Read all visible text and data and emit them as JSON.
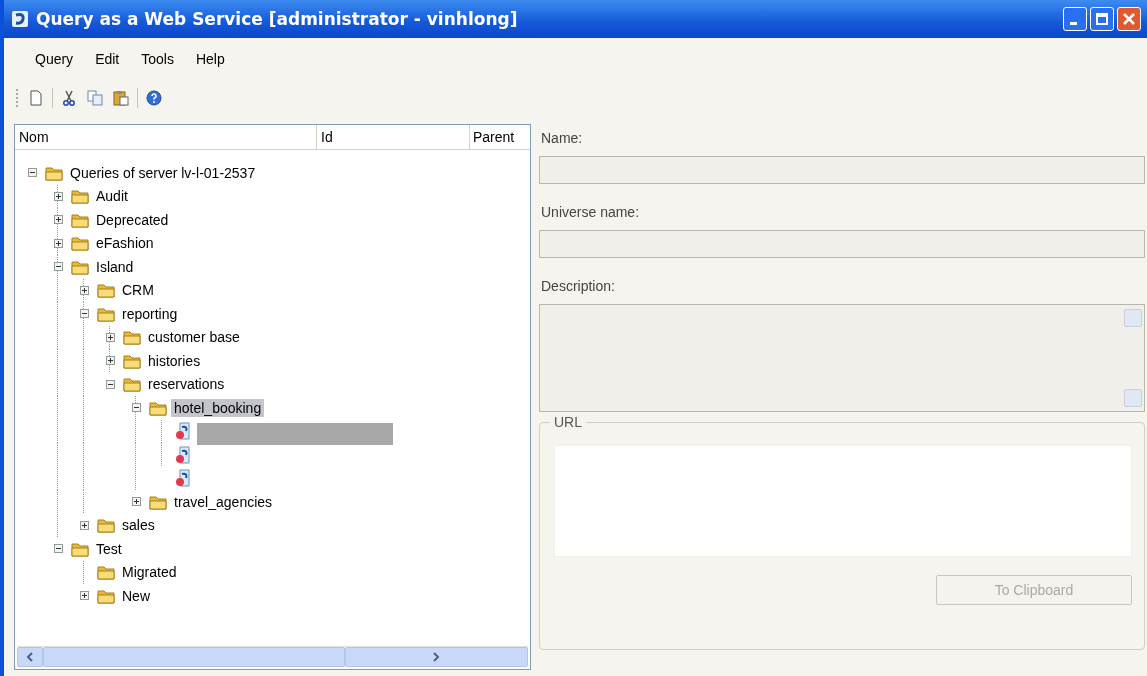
{
  "window": {
    "title": "Query as a Web Service [administrator - vinhlong]"
  },
  "menu": [
    "Query",
    "Edit",
    "Tools",
    "Help"
  ],
  "tree": {
    "columns": [
      "Nom",
      "Id",
      "Parent"
    ],
    "nodes": [
      {
        "label": "Queries of server lv-l-01-2537",
        "kind": "folder",
        "expanded": true,
        "selected": false,
        "children": [
          {
            "label": "Audit",
            "kind": "folder",
            "expanded": false,
            "selected": false
          },
          {
            "label": "Deprecated",
            "kind": "folder",
            "expanded": false,
            "selected": false
          },
          {
            "label": "eFashion",
            "kind": "folder",
            "expanded": false,
            "selected": false
          },
          {
            "label": "Island",
            "kind": "folder",
            "expanded": true,
            "selected": false,
            "children": [
              {
                "label": "CRM",
                "kind": "folder",
                "expanded": false,
                "selected": false
              },
              {
                "label": "reporting",
                "kind": "folder",
                "expanded": true,
                "selected": false,
                "children": [
                  {
                    "label": "customer base",
                    "kind": "folder",
                    "expanded": false,
                    "selected": false
                  },
                  {
                    "label": "histories",
                    "kind": "folder",
                    "expanded": false,
                    "selected": false
                  },
                  {
                    "label": "reservations",
                    "kind": "folder",
                    "expanded": true,
                    "selected": false,
                    "children": [
                      {
                        "label": "hotel_booking",
                        "kind": "folder",
                        "expanded": true,
                        "selected": true,
                        "children": [
                          {
                            "kind": "query",
                            "selected": true
                          },
                          {
                            "kind": "query",
                            "selected": false
                          },
                          {
                            "kind": "query",
                            "selected": false
                          }
                        ]
                      },
                      {
                        "label": "travel_agencies",
                        "kind": "folder",
                        "expanded": false,
                        "selected": false
                      }
                    ]
                  }
                ]
              },
              {
                "label": "sales",
                "kind": "folder",
                "expanded": false,
                "selected": false
              }
            ]
          },
          {
            "label": "Test",
            "kind": "folder",
            "expanded": true,
            "selected": false,
            "children": [
              {
                "label": "Migrated",
                "kind": "folder",
                "selected": false
              },
              {
                "label": "New",
                "kind": "folder",
                "expanded": false,
                "selected": false
              }
            ]
          }
        ]
      }
    ]
  },
  "details": {
    "name_label": "Name:",
    "universe_label": "Universe name:",
    "description_label": "Description:",
    "url_label": "URL",
    "clipboard_button": {
      "label": "To Clipboard",
      "disabled": true
    }
  }
}
